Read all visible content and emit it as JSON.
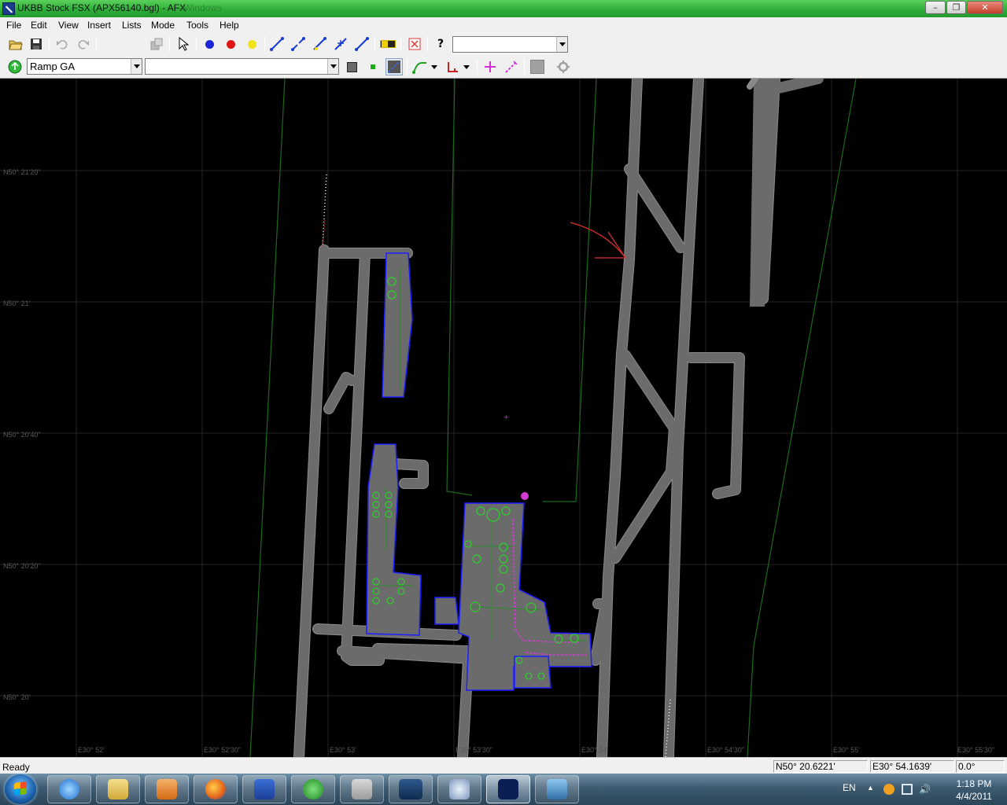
{
  "window": {
    "title": "UKBB Stock FSX (APX56140.bgl) - AFX",
    "ghost_title": "- Windows",
    "controls": {
      "minimize": "–",
      "maximize": "❐",
      "close": "✕"
    }
  },
  "menu": [
    "File",
    "Edit",
    "View",
    "Insert",
    "Lists",
    "Mode",
    "Tools",
    "Help"
  ],
  "toolbar1": {
    "buttons": [
      "open-folder-icon",
      "save-icon",
      "undo-icon",
      "redo-icon",
      "copy-disabled-icon",
      "select-arrow-icon",
      "blue-point-icon",
      "red-point-icon",
      "yellow-point-icon",
      "line-tool-1-icon",
      "line-tool-2-icon",
      "line-tool-3-icon",
      "line-tool-4-icon",
      "line-tool-5-icon",
      "taxi-sign-icon",
      "delete-icon",
      "help-icon"
    ],
    "dropdown_value": ""
  },
  "toolbar2": {
    "parking_type": "Ramp GA",
    "second_dropdown_value": ""
  },
  "map": {
    "latitude_labels": [
      "N50° 21'20\"",
      "N50° 21'",
      "N50° 20'40\"",
      "N50° 20'20\"",
      "N50° 20'"
    ],
    "longitude_labels": [
      "E30° 52'",
      "E30° 52'30\"",
      "E30° 53'",
      "E30° 53'30\"",
      "E30° 54'",
      "E30° 54'30\"",
      "E30° 55'",
      "E30° 55'30\""
    ],
    "colors": {
      "background": "#000000",
      "pavement": "#6b6b6b",
      "taxiway_edge": "#8e8e8e",
      "boundary_line": "#1f6f1f",
      "parking_circle": "#2ecf2e",
      "apron_edge": "#1d1dff",
      "taxi_path": "#d43bd4",
      "annotation_arrow": "#e03030",
      "grid": "#262626"
    }
  },
  "statusbar": {
    "status": "Ready",
    "latitude": "N50° 20.6221'",
    "longitude": "E30° 54.1639'",
    "heading": "0.0°"
  },
  "taskbar": {
    "apps": [
      "internet-explorer",
      "file-explorer",
      "media-player",
      "firefox",
      "save-disk",
      "utorrent",
      "network-tool",
      "rex",
      "search-viewer",
      "afx",
      "image-viewer"
    ],
    "active_app": "afx",
    "language": "EN",
    "time": "1:18 PM",
    "date": "4/4/2011"
  }
}
